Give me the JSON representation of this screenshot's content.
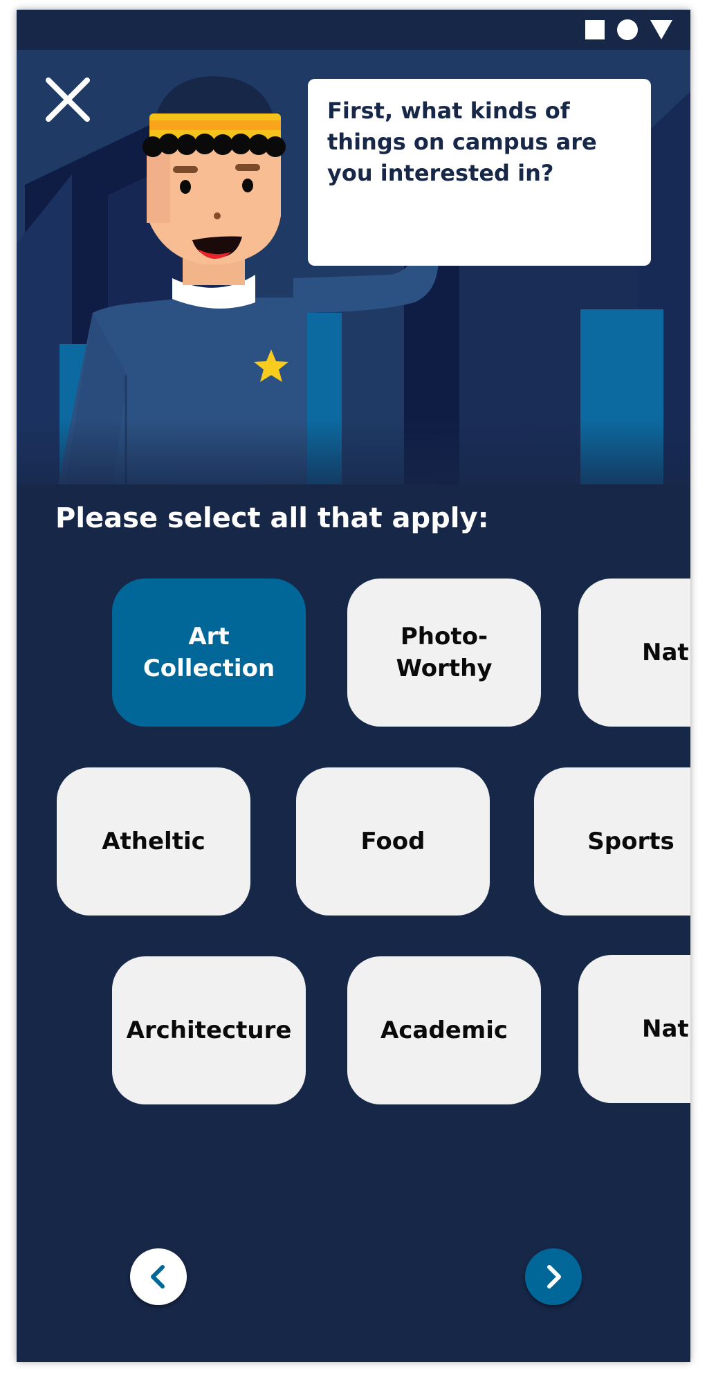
{
  "status_bar": {
    "icons": [
      "square-icon",
      "circle-icon",
      "triangle-icon"
    ]
  },
  "hero": {
    "close_icon": "close-icon",
    "speech": "First, what kinds of things on campus are you interested in?"
  },
  "prompt": "Please select all that apply:",
  "options": [
    {
      "label": "Art\nCollection",
      "selected": true
    },
    {
      "label": "Photo-\nWorthy",
      "selected": false
    },
    {
      "label": "Natu",
      "selected": false
    },
    {
      "label": "Atheltic",
      "selected": false
    },
    {
      "label": "Food",
      "selected": false
    },
    {
      "label": "Sports",
      "selected": false
    },
    {
      "label": "Architecture",
      "selected": false
    },
    {
      "label": "Academic",
      "selected": false
    },
    {
      "label": "Natu",
      "selected": false
    }
  ],
  "nav": {
    "back_icon": "chevron-left-icon",
    "next_icon": "chevron-right-icon"
  },
  "colors": {
    "background": "#172748",
    "accent": "#006798",
    "chip": "#f1f1f1",
    "hat_stripe": "#f4c21b",
    "star": "#f7cc1e"
  }
}
